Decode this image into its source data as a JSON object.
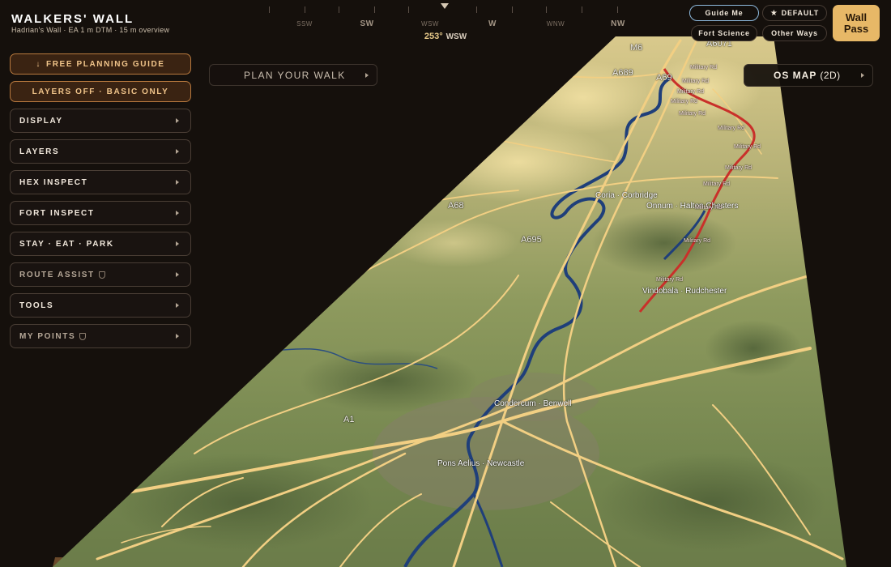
{
  "app": {
    "title": "WALKERS' WALL",
    "subtitle": "Hadrian's Wall · EA 1 m DTM · 15 m overview"
  },
  "compass": {
    "labels": [
      "SSW",
      "SW",
      "WSW",
      "W",
      "WNW",
      "NW"
    ],
    "heading": "253°",
    "heading_dir": "WSW"
  },
  "sidebar": {
    "planning_guide": "FREE PLANNING GUIDE",
    "layers_off": "LAYERS OFF · BASIC ONLY",
    "items": [
      {
        "label": "DISPLAY"
      },
      {
        "label": "LAYERS"
      },
      {
        "label": "HEX INSPECT"
      },
      {
        "label": "FORT INSPECT"
      },
      {
        "label": "STAY · EAT · PARK"
      },
      {
        "label": "ROUTE ASSIST"
      },
      {
        "label": "TOOLS"
      },
      {
        "label": "MY POINTS"
      }
    ]
  },
  "plan": {
    "label": "PLAN YOUR WALK"
  },
  "topright": {
    "guide_me": "Guide Me",
    "default": "DEFAULT",
    "fort_science": "Fort Science",
    "other_ways": "Other Ways",
    "wall_pass_line1": "Wall",
    "wall_pass_line2": "Pass",
    "os_map": "OS MAP",
    "os_map_sub": "(2D)"
  },
  "map": {
    "roads": [
      "M6",
      "A689",
      "A69",
      "A6071",
      "A68",
      "A695",
      "A1"
    ],
    "places": [
      "Coria · Corbridge",
      "Onnum · Halton Chesters",
      "Vindobala · Rudchester",
      "Condercum · Benwell",
      "Pons Aelius · Newcastle"
    ],
    "military_rd": "Military Rd"
  },
  "colors": {
    "accent": "#e7b867",
    "wall_line": "#c9302a",
    "road": "#f2cf83",
    "river": "#1f3f7a"
  }
}
